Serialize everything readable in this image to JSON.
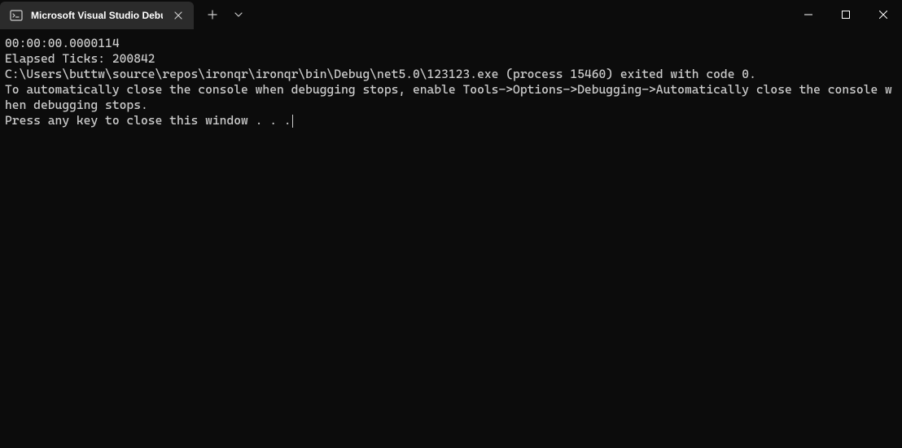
{
  "tab": {
    "title": "Microsoft Visual Studio Debug"
  },
  "console": {
    "line1": "00:00:00.0000114",
    "line2": "Elapsed Ticks: 200842",
    "blank": "",
    "line3": "C:\\Users\\buttw\\source\\repos\\ironqr\\ironqr\\bin\\Debug\\net5.0\\123123.exe (process 15460) exited with code 0.",
    "line4": "To automatically close the console when debugging stops, enable Tools->Options->Debugging->Automatically close the console when debugging stops.",
    "line5": "Press any key to close this window . . ."
  }
}
